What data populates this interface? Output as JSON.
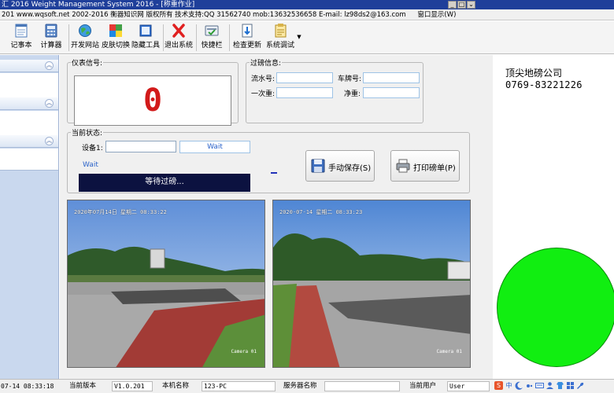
{
  "titlebar": {
    "title": "汇 2016 Weight Management System 2016 - [称重作业]",
    "controls": [
      "_",
      "□",
      "⌄"
    ]
  },
  "infobar": {
    "text": "201   www.wqsoft.net 2002-2016 衡器知识网 版权所有 技术支持:QQ 31562740 mob:13632536658  E-mail: lz98ds2@163.com",
    "menu_window": "窗口显示(W)"
  },
  "toolbar": {
    "items": [
      {
        "label": "记事本",
        "icon": "notepad-icon"
      },
      {
        "label": "计算器",
        "icon": "calculator-icon"
      },
      {
        "label": "开发网站",
        "icon": "globe-icon"
      },
      {
        "label": "皮肤切换",
        "icon": "skin-icon"
      },
      {
        "label": "隐藏工具",
        "icon": "hide-tools-icon"
      },
      {
        "label": "退出系统",
        "icon": "exit-icon"
      },
      {
        "label": "快捷栏",
        "icon": "shortcut-icon"
      },
      {
        "label": "检查更新",
        "icon": "update-icon"
      },
      {
        "label": "系统调试",
        "icon": "debug-icon"
      }
    ]
  },
  "meter": {
    "legend": "仪表信号:",
    "value": "0"
  },
  "passinfo": {
    "legend": "过磅信息:",
    "serial_label": "流水号:",
    "plate_label": "车牌号:",
    "first_weight_label": "一次重:",
    "net_weight_label": "净重:",
    "serial_value": "",
    "plate_value": "",
    "first_weight_value": "",
    "net_weight_value": ""
  },
  "status": {
    "legend": "当前状态:",
    "device_label": "设备1:",
    "device_value": "",
    "wait_box": "Wait",
    "wait_text": "Wait",
    "waiting_msg": "等待过磅..."
  },
  "buttons": {
    "save": "手动保存(S)",
    "print": "打印磅单(P)"
  },
  "cameras": [
    {
      "timestamp": "2020年07月14日 星期二 08:33:22",
      "label": "Camera 01"
    },
    {
      "timestamp": "2020-07-14 星期二 08:33:23",
      "label": "Camera 01"
    }
  ],
  "company": {
    "name": "顶尖地磅公司",
    "phone": "0769-83221226"
  },
  "signal_light": {
    "color": "#11ee11",
    "state": "green"
  },
  "statusbar": {
    "datetime": "07-14 08:33:18",
    "version_label": "当前版本",
    "version_value": "V1.0.201",
    "host_label": "本机名称",
    "host_value": "123-PC",
    "server_label": "服务器名称",
    "server_value": "",
    "user_label": "当前用户",
    "user_value": "User"
  },
  "tray": {
    "ime": "S",
    "lang": "中"
  }
}
